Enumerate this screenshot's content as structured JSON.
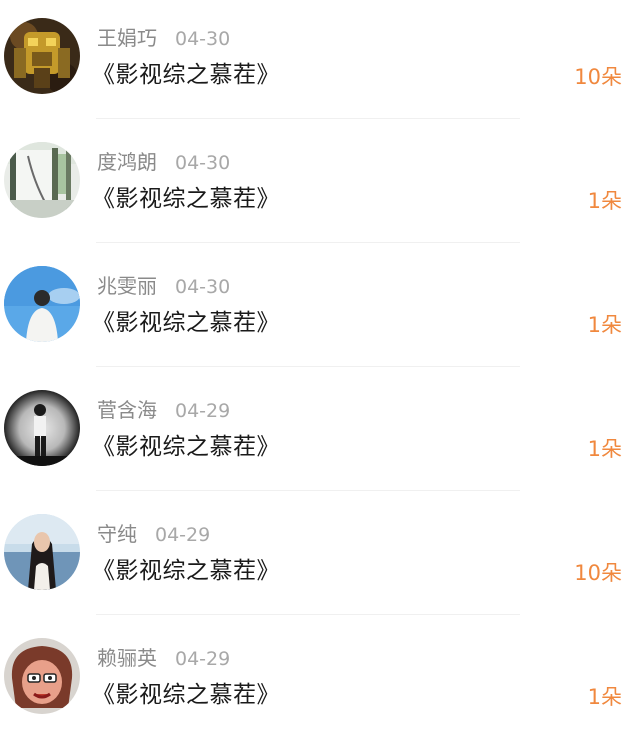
{
  "rows": [
    {
      "name": "王娟巧",
      "date": "04-30",
      "title": "《影视综之慕茬》",
      "count": "10朵",
      "avatar_icon": "robot-avatar-icon"
    },
    {
      "name": "度鸿朗",
      "date": "04-30",
      "title": "《影视综之慕茬》",
      "count": "1朵",
      "avatar_icon": "window-avatar-icon"
    },
    {
      "name": "兆雯丽",
      "date": "04-30",
      "title": "《影视综之慕茬》",
      "count": "1朵",
      "avatar_icon": "person-sky-avatar-icon"
    },
    {
      "name": "菅含海",
      "date": "04-29",
      "title": "《影视综之慕茬》",
      "count": "1朵",
      "avatar_icon": "bw-person-avatar-icon"
    },
    {
      "name": "守纯",
      "date": "04-29",
      "title": "《影视综之慕茬》",
      "count": "10朵",
      "avatar_icon": "girl-sea-avatar-icon"
    },
    {
      "name": "赖骊英",
      "date": "04-29",
      "title": "《影视综之慕茬》",
      "count": "1朵",
      "avatar_icon": "cartoon-avatar-icon"
    }
  ],
  "colors": {
    "count": "#f0883e",
    "name": "#8a8a8a",
    "date": "#a8a8a8",
    "title": "#1a1a1a"
  }
}
